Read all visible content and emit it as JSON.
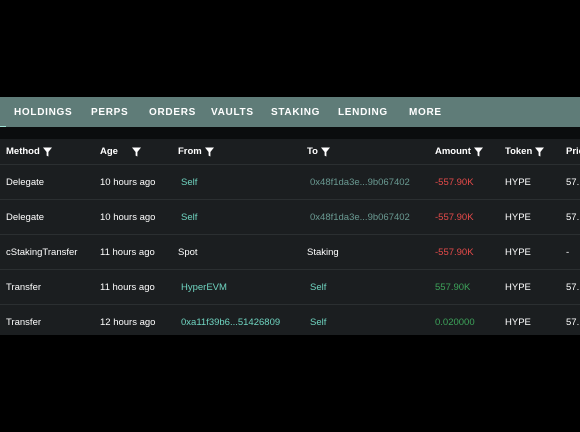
{
  "tabs": [
    {
      "label": "HOLDINGS",
      "active": true
    },
    {
      "label": "PERPS",
      "active": false
    },
    {
      "label": "ORDERS",
      "active": false
    },
    {
      "label": "VAULTS",
      "active": false
    },
    {
      "label": "STAKING",
      "active": false
    },
    {
      "label": "LENDING",
      "active": false
    },
    {
      "label": "MORE",
      "active": false
    }
  ],
  "columns": [
    "Method",
    "Age",
    "From",
    "To",
    "Amount",
    "Token",
    "Pric"
  ],
  "rows": [
    {
      "method": "Delegate",
      "age": "10 hours ago",
      "from": "Self",
      "to": "0x48f1da3e...9b067402",
      "amount": "-557.90K",
      "token": "HYPE",
      "price": "57."
    },
    {
      "method": "Delegate",
      "age": "10 hours ago",
      "from": "Self",
      "to": "0x48f1da3e...9b067402",
      "amount": "-557.90K",
      "token": "HYPE",
      "price": "57."
    },
    {
      "method": "cStakingTransfer",
      "age": "11 hours ago",
      "from": "Spot",
      "to": "Staking",
      "amount": "-557.90K",
      "token": "HYPE",
      "price": "-"
    },
    {
      "method": "Transfer",
      "age": "11 hours ago",
      "from": "HyperEVM",
      "to": "Self",
      "amount": "557.90K",
      "token": "HYPE",
      "price": "57."
    },
    {
      "method": "Transfer",
      "age": "12 hours ago",
      "from": "0xa11f39b6...51426809",
      "to": "Self",
      "amount": "0.020000",
      "token": "HYPE",
      "price": "57."
    }
  ],
  "colors": {
    "tabbar": "#5f7c78",
    "accent_teal": "#6fd4c0",
    "negative": "#e54a4a",
    "positive": "#3da35a",
    "table_bg": "#1b1e20"
  },
  "icons": {
    "filter": "filter-funnel-icon"
  }
}
